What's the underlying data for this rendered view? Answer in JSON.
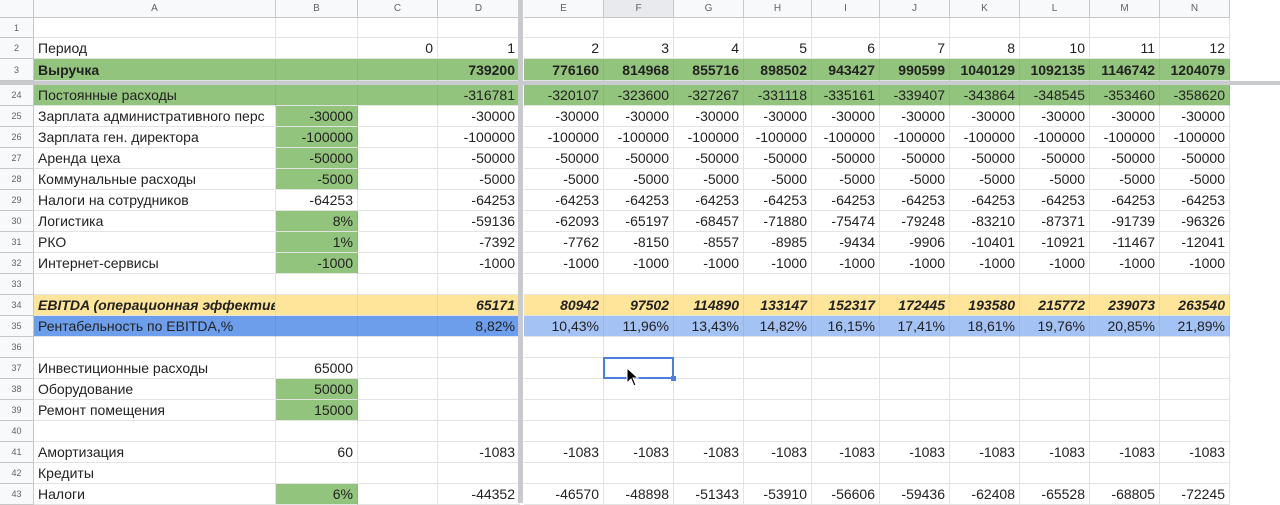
{
  "columns": [
    {
      "letter": "A",
      "w": 0
    },
    {
      "letter": "B"
    },
    {
      "letter": "C"
    },
    {
      "letter": "D"
    },
    {
      "letter": "E"
    },
    {
      "letter": "F"
    },
    {
      "letter": "G"
    },
    {
      "letter": "H"
    },
    {
      "letter": "I"
    },
    {
      "letter": "J"
    },
    {
      "letter": "K"
    },
    {
      "letter": "L"
    },
    {
      "letter": "M"
    },
    {
      "letter": "N"
    }
  ],
  "colors": {
    "green": "#93c47d",
    "yellow": "#ffe599",
    "blue": "#6d9eeb",
    "blue_num": "#a4c2f4"
  },
  "rows": [
    {
      "num": "1",
      "cells": []
    },
    {
      "num": "2",
      "cells": [
        "Период",
        "",
        "0",
        "1",
        "2",
        "3",
        "4",
        "5",
        "6",
        "7",
        "8",
        "10",
        "11",
        "12"
      ]
    },
    {
      "num": "3",
      "style": "green-bold",
      "cells": [
        "Выручка",
        "",
        "",
        "739200",
        "776160",
        "814968",
        "855716",
        "898502",
        "943427",
        "990599",
        "1040129",
        "1092135",
        "1146742",
        "1204079"
      ]
    },
    {
      "num": "24",
      "style": "green",
      "cells": [
        "Постоянные расходы",
        "",
        "",
        "-316781",
        "-320107",
        "-323600",
        "-327267",
        "-331118",
        "-335161",
        "-339407",
        "-343864",
        "-348545",
        "-353460",
        "-358620"
      ]
    },
    {
      "num": "25",
      "bgreen": true,
      "cells": [
        "Зарплата административного перс",
        "-30000",
        "",
        "-30000",
        "-30000",
        "-30000",
        "-30000",
        "-30000",
        "-30000",
        "-30000",
        "-30000",
        "-30000",
        "-30000",
        "-30000"
      ]
    },
    {
      "num": "26",
      "bgreen": true,
      "cells": [
        "Зарплата ген. директора",
        "-100000",
        "",
        "-100000",
        "-100000",
        "-100000",
        "-100000",
        "-100000",
        "-100000",
        "-100000",
        "-100000",
        "-100000",
        "-100000",
        "-100000"
      ]
    },
    {
      "num": "27",
      "bgreen": true,
      "cells": [
        "Аренда цеха",
        "-50000",
        "",
        "-50000",
        "-50000",
        "-50000",
        "-50000",
        "-50000",
        "-50000",
        "-50000",
        "-50000",
        "-50000",
        "-50000",
        "-50000"
      ]
    },
    {
      "num": "28",
      "bgreen": true,
      "cells": [
        "Коммунальные расходы",
        "-5000",
        "",
        "-5000",
        "-5000",
        "-5000",
        "-5000",
        "-5000",
        "-5000",
        "-5000",
        "-5000",
        "-5000",
        "-5000",
        "-5000"
      ]
    },
    {
      "num": "29",
      "cells": [
        "Налоги на сотрудников",
        "-64253",
        "",
        "-64253",
        "-64253",
        "-64253",
        "-64253",
        "-64253",
        "-64253",
        "-64253",
        "-64253",
        "-64253",
        "-64253",
        "-64253"
      ]
    },
    {
      "num": "30",
      "bgreen": true,
      "cells": [
        "Логистика",
        "8%",
        "",
        "-59136",
        "-62093",
        "-65197",
        "-68457",
        "-71880",
        "-75474",
        "-79248",
        "-83210",
        "-87371",
        "-91739",
        "-96326"
      ]
    },
    {
      "num": "31",
      "bgreen": true,
      "cells": [
        "РКО",
        "1%",
        "",
        "-7392",
        "-7762",
        "-8150",
        "-8557",
        "-8985",
        "-9434",
        "-9906",
        "-10401",
        "-10921",
        "-11467",
        "-12041"
      ]
    },
    {
      "num": "32",
      "bgreen": true,
      "cells": [
        "Интернет-сервисы",
        "-1000",
        "",
        "-1000",
        "-1000",
        "-1000",
        "-1000",
        "-1000",
        "-1000",
        "-1000",
        "-1000",
        "-1000",
        "-1000",
        "-1000"
      ]
    },
    {
      "num": "33",
      "cells": []
    },
    {
      "num": "34",
      "style": "yellow",
      "cells": [
        "EBITDA (операционная эффективность)",
        "",
        "",
        "65171",
        "80942",
        "97502",
        "114890",
        "133147",
        "152317",
        "172445",
        "193580",
        "215772",
        "239073",
        "263540"
      ]
    },
    {
      "num": "35",
      "style": "blue",
      "cells": [
        "Рентабельность по EBITDA,%",
        "",
        "",
        "8,82%",
        "10,43%",
        "11,96%",
        "13,43%",
        "14,82%",
        "16,15%",
        "17,41%",
        "18,61%",
        "19,76%",
        "20,85%",
        "21,89%"
      ]
    },
    {
      "num": "36",
      "cells": []
    },
    {
      "num": "37",
      "cells": [
        "Инвестиционные расходы",
        "65000"
      ]
    },
    {
      "num": "38",
      "bgreen": true,
      "cells": [
        "Оборудование",
        "50000"
      ]
    },
    {
      "num": "39",
      "bgreen": true,
      "cells": [
        "Ремонт помещения",
        "15000"
      ]
    },
    {
      "num": "40",
      "cells": []
    },
    {
      "num": "41",
      "cells": [
        "Амортизация",
        "60",
        "",
        "-1083",
        "-1083",
        "-1083",
        "-1083",
        "-1083",
        "-1083",
        "-1083",
        "-1083",
        "-1083",
        "-1083",
        "-1083"
      ]
    },
    {
      "num": "42",
      "cells": [
        "Кредиты"
      ]
    },
    {
      "num": "43",
      "bgreen": true,
      "cells": [
        "Налоги",
        "6%",
        "",
        "-44352",
        "-46570",
        "-48898",
        "-51343",
        "-53910",
        "-56606",
        "-59436",
        "-62408",
        "-65528",
        "-68805",
        "-72245"
      ]
    }
  ],
  "selection": {
    "column": "F",
    "row": "37"
  }
}
